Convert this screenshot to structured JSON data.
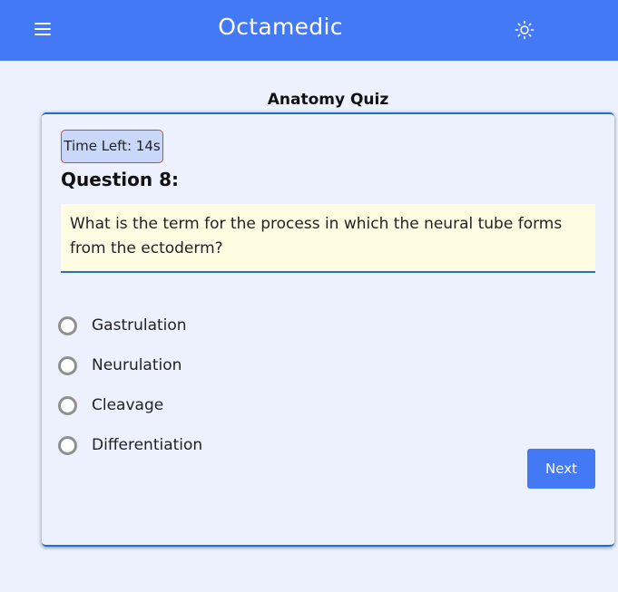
{
  "header": {
    "brand": "Octamedic",
    "menu_icon": "hamburger-menu-icon",
    "theme_icon": "sun-icon"
  },
  "quiz": {
    "title": "Anatomy Quiz",
    "timer_text": "Time Left: 14s",
    "question_heading": "Question 8:",
    "question_text": "What is the term for the process in which the neural tube forms from the ectoderm?",
    "options": [
      {
        "label": "Gastrulation",
        "selected": false
      },
      {
        "label": "Neurulation",
        "selected": false
      },
      {
        "label": "Cleavage",
        "selected": false
      },
      {
        "label": "Differentiation",
        "selected": false
      }
    ],
    "next_label": "Next"
  },
  "colors": {
    "header_bg": "#4479f5",
    "page_bg": "#ecf1fd",
    "accent": "#1f6fd1",
    "question_bg": "#fefde3",
    "timer_bg": "#c9d8f9",
    "timer_border": "#e23b3b"
  }
}
